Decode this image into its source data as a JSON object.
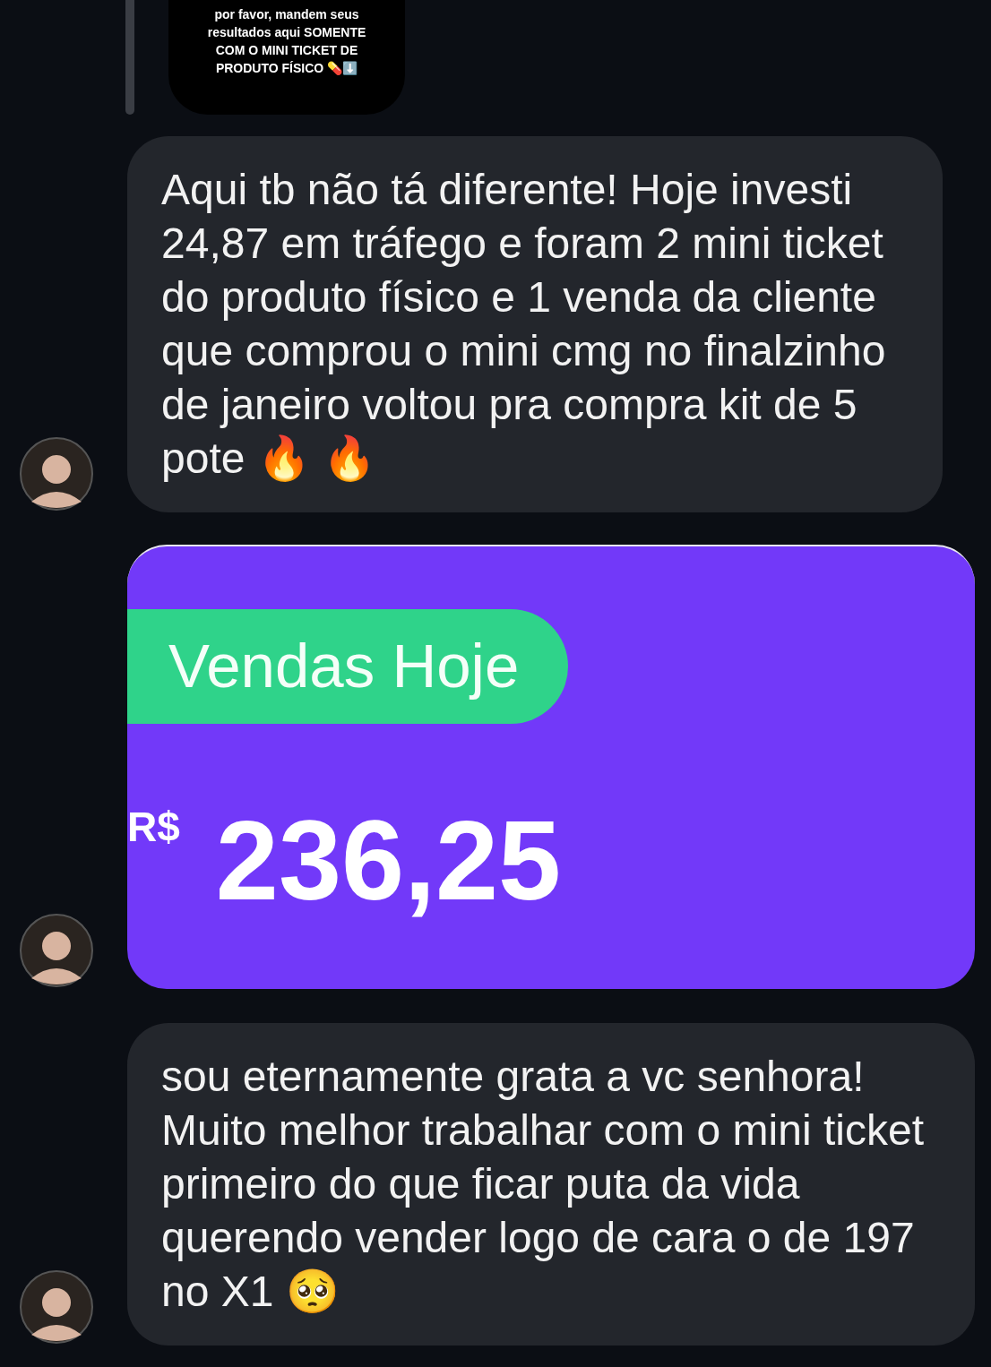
{
  "story_reply": {
    "lines": [
      "por favor, mandem seus",
      "resultados aqui SOMENTE",
      "COM O MINI TICKET DE",
      "PRODUTO FÍSICO 💊⬇️"
    ]
  },
  "messages": [
    {
      "kind": "text",
      "text": "Aqui tb não tá diferente! Hoje investi 24,87 em tráfego e foram 2 mini ticket do produto físico e 1 venda da cliente que comprou o mini cmg no finalzinho de janeiro voltou pra compra kit de 5 pote 🔥 🔥"
    },
    {
      "kind": "image",
      "badge": "Vendas Hoje",
      "currency": "R$",
      "amount": "236,25"
    },
    {
      "kind": "text",
      "text": "sou eternamente grata a vc senhora! Muito melhor trabalhar com o mini ticket primeiro do que ficar puta da vida querendo vender logo de cara o de 197 no X1 🥺"
    }
  ]
}
